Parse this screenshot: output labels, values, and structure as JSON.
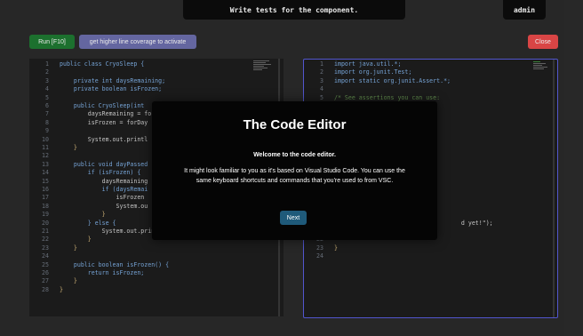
{
  "header": {
    "title": "Write tests for the component.",
    "user": "admin"
  },
  "toolbar": {
    "run_label": "Run [F10]",
    "coverage_label": "get higher line coverage to activate",
    "close_label": "Close"
  },
  "colors": {
    "run": "#1f7a32",
    "coverage": "#6d6fae",
    "close": "#ec4b4b",
    "editor_bg": "#1e1e1e",
    "focus_border": "#5a5ee0"
  },
  "left_editor": {
    "lines": [
      {
        "n": "1",
        "t": "public class CryoSleep {"
      },
      {
        "n": "2",
        "t": ""
      },
      {
        "n": "3",
        "t": "    private int daysRemaining;"
      },
      {
        "n": "4",
        "t": "    private boolean isFrozen;"
      },
      {
        "n": "5",
        "t": ""
      },
      {
        "n": "6",
        "t": "    public CryoSleep(int "
      },
      {
        "n": "7",
        "t": "        daysRemaining = fo"
      },
      {
        "n": "8",
        "t": "        isFrozen = forDay"
      },
      {
        "n": "9",
        "t": ""
      },
      {
        "n": "10",
        "t": "        System.out.printl"
      },
      {
        "n": "11",
        "t": "    }"
      },
      {
        "n": "12",
        "t": ""
      },
      {
        "n": "13",
        "t": "    public void dayPassed"
      },
      {
        "n": "14",
        "t": "        if (isFrozen) {"
      },
      {
        "n": "15",
        "t": "            daysRemaining"
      },
      {
        "n": "16",
        "t": "            if (daysRemai"
      },
      {
        "n": "17",
        "t": "                isFrozen "
      },
      {
        "n": "18",
        "t": "                System.ou"
      },
      {
        "n": "19",
        "t": "            }"
      },
      {
        "n": "20",
        "t": "        } else {"
      },
      {
        "n": "21",
        "t": "            System.out.println(\"CryoSleep is already"
      },
      {
        "n": "22",
        "t": "        }"
      },
      {
        "n": "23",
        "t": "    }"
      },
      {
        "n": "24",
        "t": ""
      },
      {
        "n": "25",
        "t": "    public boolean isFrozen() {"
      },
      {
        "n": "26",
        "t": "        return isFrozen;"
      },
      {
        "n": "27",
        "t": "    }"
      },
      {
        "n": "28",
        "t": "}"
      }
    ]
  },
  "right_editor": {
    "lines": [
      {
        "n": "1",
        "t": "import java.util.*;"
      },
      {
        "n": "2",
        "t": "import org.junit.Test;"
      },
      {
        "n": "3",
        "t": "import static org.junit.Assert.*;"
      },
      {
        "n": "4",
        "t": ""
      },
      {
        "n": "5",
        "t": "/* See assertions you can use:"
      },
      {
        "n": "20",
        "t": "                                    d yet!\");"
      },
      {
        "n": "21",
        "t": "    }"
      },
      {
        "n": "22",
        "t": ""
      },
      {
        "n": "23",
        "t": "}"
      },
      {
        "n": "24",
        "t": ""
      }
    ]
  },
  "modal": {
    "title": "The Code Editor",
    "subtitle": "Welcome to the code editor.",
    "body": "It might look familiar to you as it's based on Visual Studio Code. You can use the same keyboard shortcuts and commands that you're used to from VSC.",
    "next_label": "Next"
  }
}
